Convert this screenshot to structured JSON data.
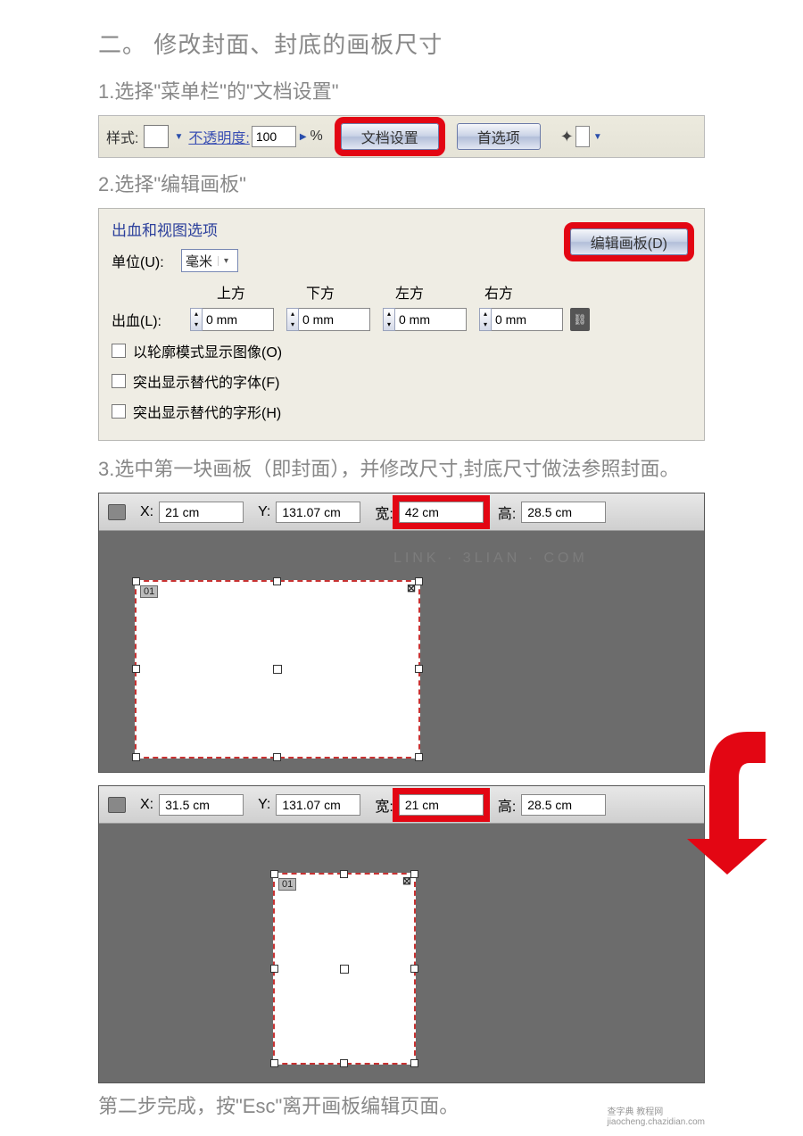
{
  "heading": "二。 修改封面、封底的画板尺寸",
  "step1": "1.选择\"菜单栏\"的\"文档设置\"",
  "toolbar1": {
    "style_label": "样式:",
    "opacity_label": "不透明度:",
    "opacity_value": "100",
    "percent": "%",
    "doc_setup_btn": "文档设置",
    "prefs_btn": "首选项"
  },
  "step2": "2.选择\"编辑画板\"",
  "panel": {
    "legend": "出血和视图选项",
    "unit_label": "单位(U):",
    "unit_value": "毫米",
    "edit_artboard_btn": "编辑画板(D)",
    "col_top": "上方",
    "col_bottom": "下方",
    "col_left": "左方",
    "col_right": "右方",
    "bleed_label": "出血(L):",
    "bleed_top": "0 mm",
    "bleed_bottom": "0 mm",
    "bleed_left": "0 mm",
    "bleed_right": "0 mm",
    "cb1": "以轮廓模式显示图像(O)",
    "cb2": "突出显示替代的字体(F)",
    "cb3": "突出显示替代的字形(H)"
  },
  "step3": "3.选中第一块画板（即封面），并修改尺寸,封底尺寸做法参照封面。",
  "editorA": {
    "x_label": "X:",
    "x_val": "21 cm",
    "y_label": "Y:",
    "y_val": "131.07 cm",
    "w_label": "宽:",
    "w_val": "42 cm",
    "h_label": "高:",
    "h_val": "28.5 cm",
    "ab_num": "01"
  },
  "editorB": {
    "x_label": "X:",
    "x_val": "31.5 cm",
    "y_label": "Y:",
    "y_val": "131.07 cm",
    "w_label": "宽:",
    "w_val": "21 cm",
    "h_label": "高:",
    "h_val": "28.5 cm",
    "ab_num": "01"
  },
  "step_done": "第二步完成，按\"Esc\"离开画板编辑页面。",
  "footer_brand": "查字典 教程网",
  "footer_url": "jiaocheng.chazidian.com"
}
